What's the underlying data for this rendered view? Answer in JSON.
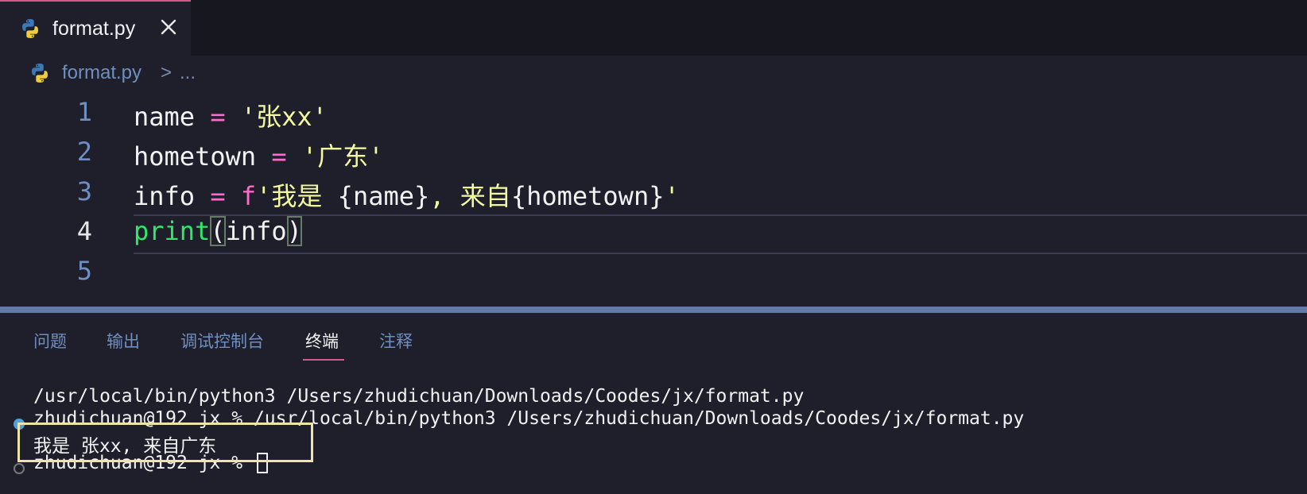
{
  "tab": {
    "label": "format.py"
  },
  "breadcrumb": {
    "file": "format.py",
    "separator": ">",
    "more": "..."
  },
  "editor": {
    "line_numbers": [
      "1",
      "2",
      "3",
      "4",
      "5"
    ],
    "lines": {
      "l1": {
        "a": "name ",
        "b": "=",
        "c": " ",
        "d": "'张xx'"
      },
      "l2": {
        "a": "hometown ",
        "b": "=",
        "c": " ",
        "d": "'广东'"
      },
      "l3": {
        "a": "info ",
        "b": "=",
        "c": " ",
        "d": "f",
        "e": "'我是 ",
        "f": "{name}",
        "g": ", 来自",
        "h": "{hometown}",
        "i": "'"
      },
      "l4": {
        "a": "print",
        "b": "(",
        "c": "info",
        "d": ")"
      }
    }
  },
  "panel": {
    "tabs": [
      "问题",
      "输出",
      "调试控制台",
      "终端",
      "注释"
    ],
    "active_tab": "终端"
  },
  "terminal": {
    "line1": "/usr/local/bin/python3 /Users/zhudichuan/Downloads/Coodes/jx/format.py",
    "line2": "zhudichuan@192 jx % /usr/local/bin/python3 /Users/zhudichuan/Downloads/Coodes/jx/format.py",
    "line3": "我是 张xx, 来自广东",
    "line4": "zhudichuan@192 jx % "
  },
  "colors": {
    "accent": "#d6598a",
    "panel_border": "#6378ad",
    "highlight_box": "#f0e3a6"
  },
  "icons": {
    "file": "python-icon",
    "close": "close-icon"
  }
}
